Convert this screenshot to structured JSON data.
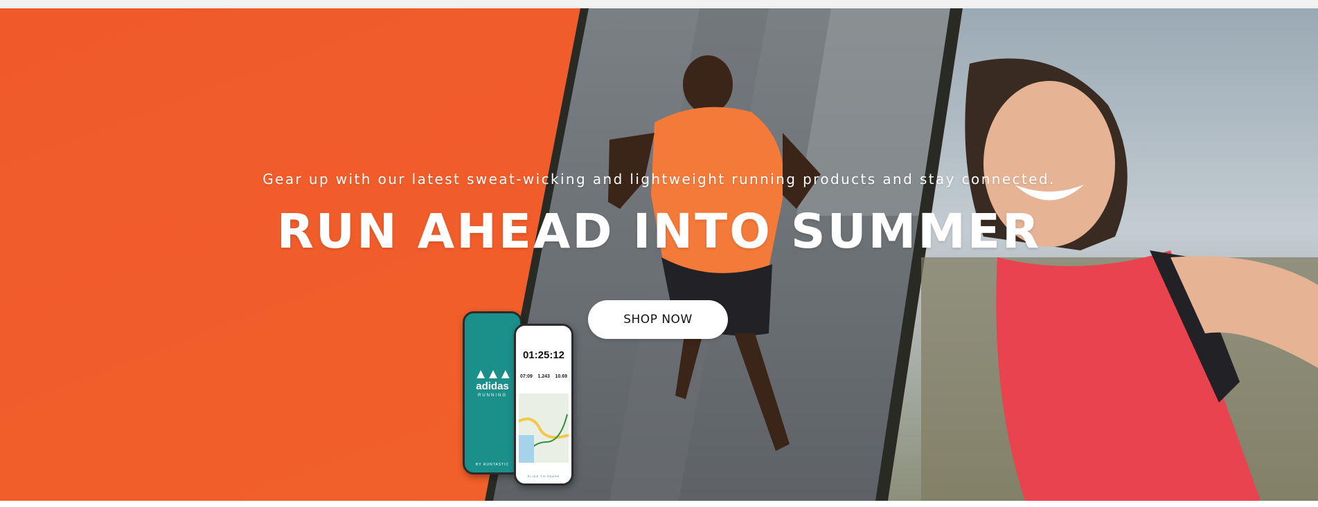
{
  "hero": {
    "tagline": "Gear up with our latest sweat-wicking and lightweight running products and stay connected.",
    "headline": "RUN AHEAD INTO SUMMER",
    "cta_label": "SHOP NOW"
  },
  "phone_app": {
    "brand": "adidas",
    "subtitle": "RUNNING",
    "byline": "BY RUNTASTIC",
    "timer": "01:25:12",
    "stats": [
      "07:09",
      "1.243",
      "10.69"
    ],
    "map_button": "SLIDE TO PAUSE"
  },
  "colors": {
    "panel_orange": "#f15a2c",
    "runner_shirt": "#f47a3a",
    "tank_top": "#e8434e",
    "app_teal": "#1b8f8a"
  },
  "icons": {
    "brand_logo": "adidas-performance-logo"
  }
}
